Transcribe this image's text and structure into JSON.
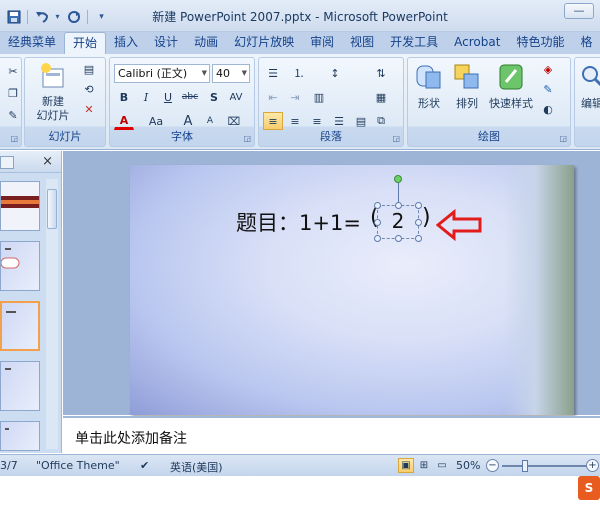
{
  "window": {
    "title": "新建 PowerPoint 2007.pptx - Microsoft PowerPoint",
    "control_glyph": "—"
  },
  "quick_access": {
    "save_icon": "save-icon",
    "undo_icon": "undo-icon",
    "redo_icon": "redo-icon",
    "customize_glyph": "▾"
  },
  "ribbon_tabs": [
    "经典菜单",
    "开始",
    "插入",
    "设计",
    "动画",
    "幻灯片放映",
    "审阅",
    "视图",
    "开发工具",
    "Acrobat",
    "特色功能",
    "格"
  ],
  "ribbon": {
    "slides_group": {
      "label": "幻灯片",
      "new_slide": "新建\n幻灯片"
    },
    "font_group": {
      "label": "字体",
      "font_name": "Calibri (正文)",
      "font_size": "40",
      "bold": "B",
      "italic": "I",
      "underline": "U",
      "strikethrough": "abc",
      "shadow": "S",
      "spacing": "AV",
      "font_color": "A",
      "change_case": "Aa",
      "grow": "A",
      "shrink": "A"
    },
    "paragraph_group": {
      "label": "段落"
    },
    "drawing_group": {
      "label": "绘图",
      "shapes": "形状",
      "arrange": "排列",
      "quick_styles": "快速样式"
    },
    "editing_group": {
      "edit": "编辑"
    }
  },
  "slide": {
    "question": "题目：1+1=",
    "answer": "2",
    "left_paren": "(",
    "right_paren": ")"
  },
  "notes": {
    "placeholder": "单击此处添加备注"
  },
  "status_bar": {
    "slide_counter": "3/7",
    "theme": "\"Office Theme\"",
    "language": "英语(美国)",
    "zoom": "50%",
    "zoom_minus": "−",
    "zoom_plus": "+"
  },
  "left_panel": {
    "close_glyph": "×"
  },
  "colors": {
    "accent_arrow": "#e21b1b",
    "ribbon_blue": "#15428b",
    "selection_orange": "#f2a14a"
  }
}
